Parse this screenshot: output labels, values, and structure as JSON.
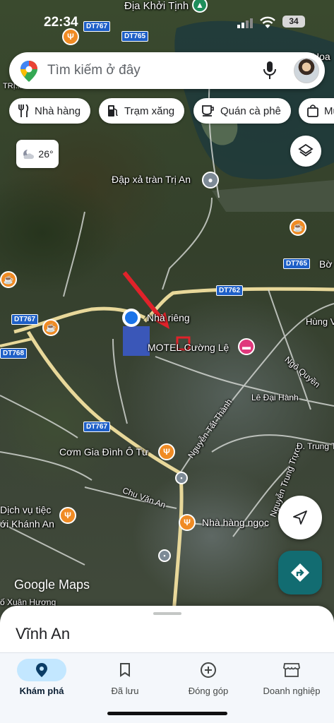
{
  "status_bar": {
    "time": "22:34",
    "battery": "34"
  },
  "search": {
    "placeholder": "Tìm kiếm ở đây"
  },
  "chips": [
    {
      "label": "Nhà hàng",
      "icon": "fork-knife-icon"
    },
    {
      "label": "Trạm xăng",
      "icon": "gas-station-icon"
    },
    {
      "label": "Quán cà phê",
      "icon": "coffee-icon"
    },
    {
      "label": "Mu",
      "icon": "shopping-bag-icon"
    }
  ],
  "weather": {
    "temp": "26°",
    "icon": "cloudy-night-icon"
  },
  "map": {
    "labels": {
      "dia_khoi_tinh": "Địa Khởi Tịnh",
      "dap_xa_tran": "Đập xả tràn Trị An",
      "nha_rieng": "Nhà riêng",
      "motel": "MOTEL Cường Lệ",
      "ngo_quyen": "Ngô Quyền",
      "le_dai_hanh": "Lê Đại Hành",
      "nguyen_tat_thanh": "Nguyễn Tất Thành",
      "nguyen_trung_truc": "Nguyễn Trung Trực",
      "d_trung_ta": "Đ. Trung Tâ",
      "hung_v": "Hùng V",
      "bo": "Bờ",
      "com_gia_dinh": "Cơm Gia Đình Ô Tư",
      "chu_van_an": "Chu Văn An",
      "nha_hang_ngoc": "Nhà hàng ngọc",
      "dich_vu_tiec_1": "Dịch vụ tiệc",
      "dich_vu_tiec_2": "ới Khánh An",
      "xuan_huong": "ố Xuân Hương",
      "tri": "TRỊ...",
      "hoa": "Hoa"
    },
    "shields": {
      "dt767a": "DT767",
      "dt765a": "DT765",
      "dt765b": "DT765",
      "dt762": "DT762",
      "dt767b": "DT767",
      "dt768": "DT768",
      "dt767c": "DT767"
    },
    "attribution": "Google Maps"
  },
  "sheet": {
    "title": "Vĩnh An"
  },
  "nav": [
    {
      "label": "Khám phá",
      "icon": "explore-pin-icon",
      "active": true
    },
    {
      "label": "Đã lưu",
      "icon": "bookmark-icon",
      "active": false
    },
    {
      "label": "Đóng góp",
      "icon": "add-circle-icon",
      "active": false
    },
    {
      "label": "Doanh nghiệp",
      "icon": "storefront-icon",
      "active": false
    }
  ],
  "colors": {
    "accent_blue": "#1a73e8",
    "directions_teal": "#126c71",
    "nav_active_pill": "#c3e7ff",
    "annotation_red": "#e0222a"
  }
}
